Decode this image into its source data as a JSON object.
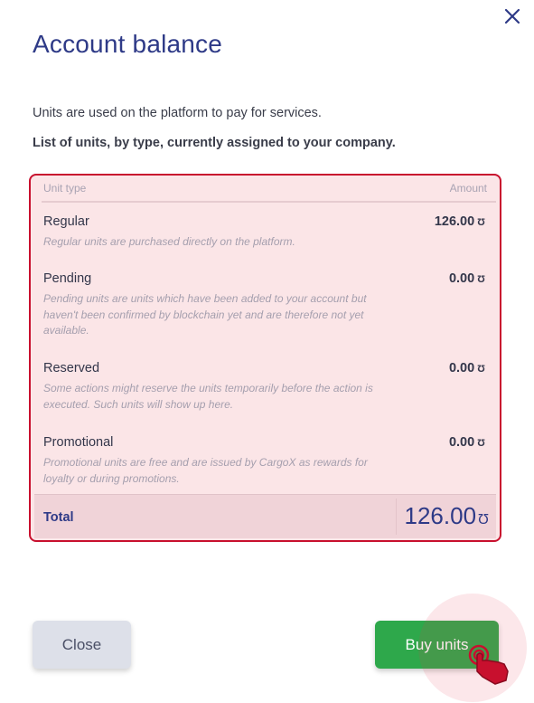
{
  "dialog": {
    "title": "Account balance",
    "close_icon": "close-icon",
    "intro": "Units are used on the platform to pay for services.",
    "intro_bold": "List of units, by type, currently assigned to your company."
  },
  "table": {
    "headers": {
      "type": "Unit type",
      "amount": "Amount"
    },
    "unit_symbol": "Ʊ",
    "rows": [
      {
        "name": "Regular",
        "description": "Regular units are purchased directly on the platform.",
        "amount": "126.00"
      },
      {
        "name": "Pending",
        "description": "Pending units are units which have been added to your account but haven't been confirmed by blockchain yet and are therefore not yet available.",
        "amount": "0.00"
      },
      {
        "name": "Reserved",
        "description": "Some actions might reserve the units temporarily before the action is executed. Such units will show up here.",
        "amount": "0.00"
      },
      {
        "name": "Promotional",
        "description": "Promotional units are free and are issued by CargoX as rewards for loyalty or during promotions.",
        "amount": "0.00"
      }
    ],
    "total": {
      "label": "Total",
      "amount": "126.00"
    }
  },
  "buttons": {
    "close_label": "Close",
    "buy_label": "Buy units"
  },
  "colors": {
    "highlight_border": "#c8102e",
    "highlight_fill": "#fbe5e7",
    "primary_text": "#2e3a87",
    "buy_button": "#2ea84b",
    "close_button": "#dde0e9"
  },
  "cursor_icon": "hand-pointer-icon"
}
